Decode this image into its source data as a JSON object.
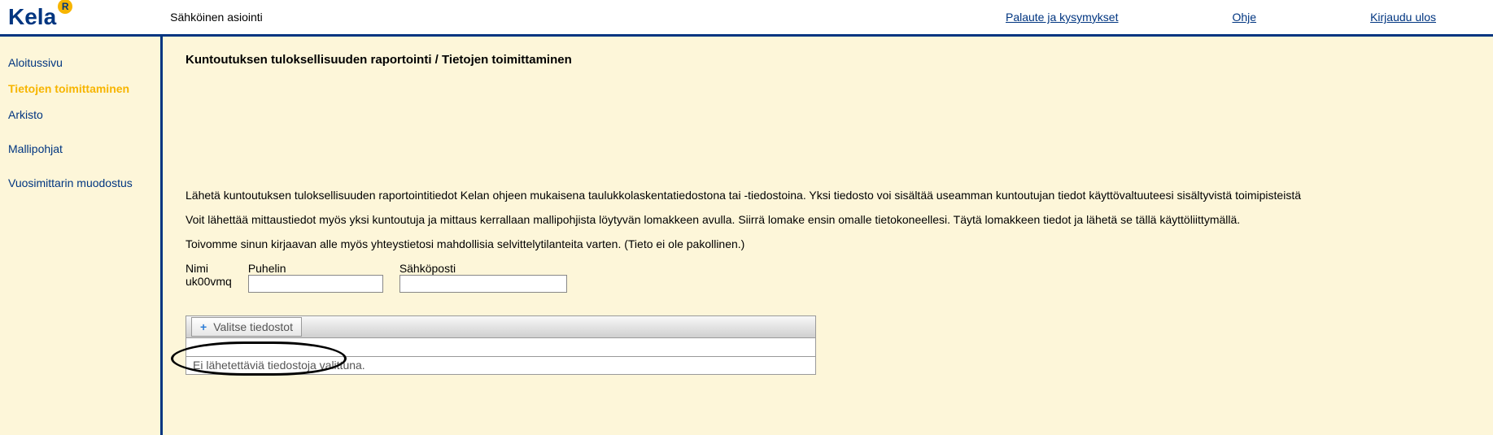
{
  "header": {
    "logo_text": "Kela",
    "logo_badge": "R",
    "title": "Sähköinen asiointi",
    "links": {
      "feedback": "Palaute ja kysymykset",
      "help": "Ohje",
      "logout": "Kirjaudu ulos"
    }
  },
  "sidebar": {
    "items": [
      {
        "label": "Aloitussivu",
        "active": false
      },
      {
        "label": "Tietojen toimittaminen",
        "active": true
      },
      {
        "label": "Arkisto",
        "active": false
      },
      {
        "label": "Mallipohjat",
        "active": false
      },
      {
        "label": "Vuosimittarin muodostus",
        "active": false
      }
    ]
  },
  "main": {
    "title": "Kuntoutuksen tuloksellisuuden raportointi / Tietojen toimittaminen",
    "para1": "Lähetä kuntoutuksen tuloksellisuuden raportointitiedot Kelan ohjeen mukaisena taulukkolaskentatiedostona tai -tiedostoina. Yksi tiedosto voi sisältää useamman kuntoutujan tiedot käyttövaltuuteesi sisältyvistä toimipisteistä",
    "para2": "Voit lähettää mittaustiedot myös yksi kuntoutuja ja mittaus kerrallaan mallipohjista löytyvän lomakkeen avulla. Siirrä lomake ensin omalle tietokoneellesi. Täytä lomakkeen tiedot ja lähetä se tällä käyttöliittymällä.",
    "para3": "Toivomme sinun kirjaavan alle myös yhteystietosi mahdollisia selvittelytilanteita varten. (Tieto ei ole pakollinen.)",
    "fields": {
      "name_label": "Nimi",
      "name_value": "uk00vmq",
      "phone_label": "Puhelin",
      "phone_value": "",
      "email_label": "Sähköposti",
      "email_value": ""
    },
    "upload": {
      "choose_label": "Valitse tiedostot",
      "empty_msg": "Ei lähetettäviä tiedostoja valittuna."
    }
  }
}
